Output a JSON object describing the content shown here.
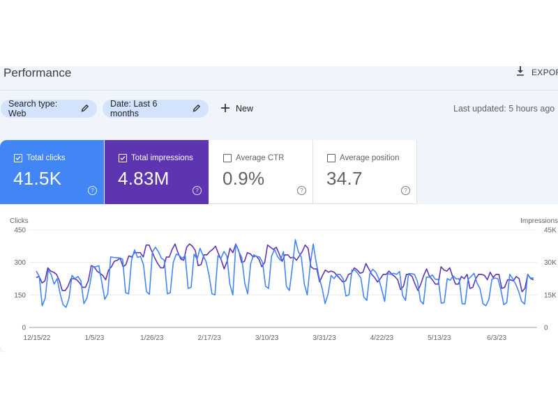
{
  "header": {
    "title": "Performance",
    "export_label": "EXPORT",
    "export_icon": "download-icon"
  },
  "filters": {
    "search_type": "Search type: Web",
    "date": "Date: Last 6 months",
    "new_label": "New",
    "edit_icon": "pencil-icon",
    "add_icon": "plus-icon",
    "last_updated": "Last updated: 5 hours ago"
  },
  "metrics": [
    {
      "label": "Total clicks",
      "value": "41.5K",
      "checked": true,
      "color": "#4285f4"
    },
    {
      "label": "Total impressions",
      "value": "4.83M",
      "checked": true,
      "color": "#5e35b1"
    },
    {
      "label": "Average CTR",
      "value": "0.9%",
      "checked": false,
      "color": "#ffffff"
    },
    {
      "label": "Average position",
      "value": "34.7",
      "checked": false,
      "color": "#ffffff"
    }
  ],
  "help_glyph": "?",
  "chart_data": {
    "type": "line",
    "left_axis_label": "Clicks",
    "right_axis_label": "Impressions",
    "left_ticks": [
      "0",
      "150",
      "300",
      "450"
    ],
    "right_ticks": [
      "0",
      "15K",
      "30K",
      "45K"
    ],
    "left_ylim": [
      0,
      450
    ],
    "right_ylim": [
      0,
      45000
    ],
    "x_ticks": [
      "12/15/22",
      "1/5/23",
      "1/26/23",
      "2/17/23",
      "3/10/23",
      "3/31/23",
      "4/22/23",
      "5/13/23",
      "6/3/23"
    ],
    "grid": true,
    "series": [
      {
        "name": "Clicks",
        "axis": "left",
        "color": "#4285f4",
        "values": [
          260,
          235,
          100,
          135,
          265,
          245,
          200,
          225,
          155,
          105,
          93,
          135,
          240,
          225,
          235,
          215,
          110,
          135,
          200,
          280,
          280,
          285,
          210,
          130,
          155,
          325,
          323,
          322,
          320,
          315,
          160,
          155,
          310,
          358,
          323,
          328,
          290,
          165,
          153,
          348,
          370,
          350,
          320,
          310,
          155,
          160,
          300,
          338,
          333,
          318,
          332,
          180,
          185,
          338,
          315,
          365,
          332,
          305,
          243,
          155,
          150,
          330,
          318,
          350,
          330,
          200,
          150,
          385,
          350,
          323,
          205,
          155,
          295,
          335,
          328,
          325,
          300,
          190,
          180,
          328,
          360,
          328,
          310,
          350,
          190,
          170,
          280,
          405,
          350,
          325,
          200,
          150,
          290,
          385,
          300,
          230,
          180,
          110,
          155,
          240,
          225,
          245,
          245,
          225,
          145,
          150,
          265,
          265,
          248,
          228,
          140,
          125,
          248,
          268,
          255,
          225,
          175,
          120,
          248,
          245,
          250,
          245,
          258,
          148,
          125,
          248,
          248,
          245,
          212,
          122,
          108,
          232,
          232,
          242,
          222,
          222,
          112,
          115,
          225,
          218,
          238,
          224,
          225,
          110,
          108,
          222,
          235,
          250,
          205,
          180,
          110,
          100,
          130,
          222,
          228,
          225,
          175,
          105,
          115,
          245,
          225,
          200,
          165,
          120,
          108,
          242,
          228,
          228
        ]
      },
      {
        "name": "Impressions",
        "axis": "right",
        "color": "#5e35b1",
        "values": [
          23000,
          23500,
          20500,
          21500,
          27500,
          26000,
          25500,
          24500,
          21500,
          17000,
          17000,
          19000,
          22500,
          22500,
          22000,
          20500,
          18500,
          18500,
          21500,
          28500,
          28000,
          26000,
          25000,
          24000,
          22000,
          26500,
          28000,
          30500,
          31000,
          32000,
          28000,
          29000,
          33000,
          32500,
          34500,
          34500,
          34500,
          32500,
          38000,
          38000,
          35000,
          32000,
          29500,
          27500,
          27500,
          32500,
          32500,
          36000,
          38500,
          34500,
          31500,
          31000,
          37000,
          38500,
          37500,
          35500,
          28500,
          29000,
          33500,
          33500,
          35000,
          36000,
          37500,
          34000,
          31000,
          27000,
          30500,
          36500,
          34500,
          38500,
          35500,
          30000,
          30500,
          34500,
          34000,
          32500,
          33000,
          31500,
          28000,
          30000,
          38000,
          37000,
          36000,
          37000,
          34000,
          30500,
          33500,
          33500,
          32000,
          32500,
          31000,
          33000,
          35000,
          38000,
          36500,
          28000,
          27000,
          27000,
          21000,
          24000,
          26500,
          25500,
          26000,
          25500,
          24000,
          22500,
          21000,
          21500,
          24500,
          25000,
          27500,
          26500,
          25000,
          25500,
          29500,
          27000,
          24500,
          23000,
          21000,
          22500,
          24500,
          24500,
          26000,
          24500,
          23500,
          22000,
          17500,
          19000,
          24500,
          24500,
          23500,
          20000,
          17000,
          20000,
          24000,
          27000,
          23500,
          22000,
          20000,
          20000,
          28000,
          26500,
          26000,
          27500,
          23500,
          20000,
          20000,
          23500,
          22500,
          24500,
          18000,
          18500,
          22500,
          24500,
          24500,
          24000,
          22000,
          25500,
          23000,
          24500,
          24500,
          18000,
          18500,
          22000,
          22000,
          21500,
          23500,
          22500,
          16500,
          18000,
          24500,
          22500,
          22000
        ]
      }
    ]
  }
}
